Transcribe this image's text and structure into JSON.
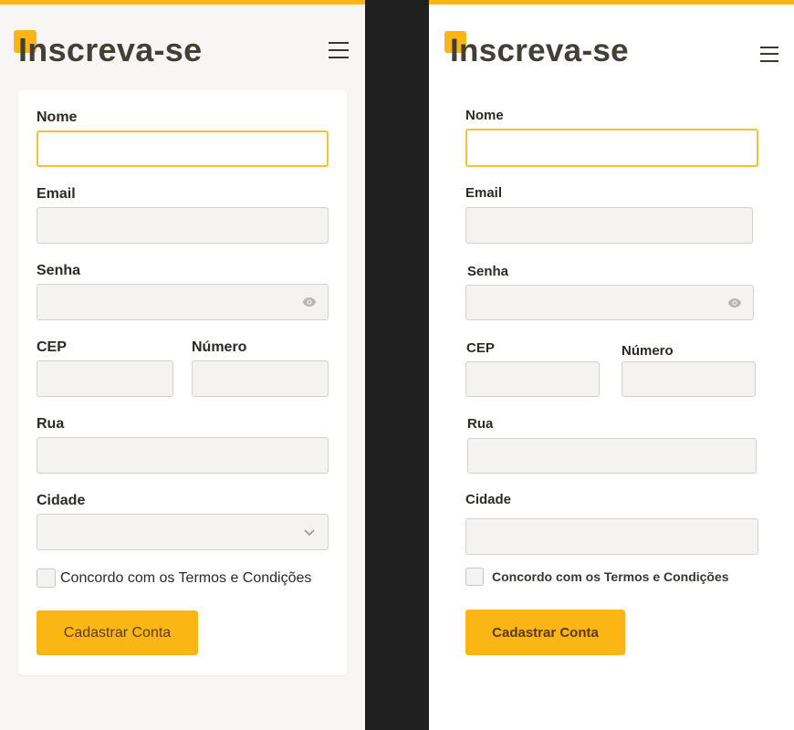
{
  "colors": {
    "accent": "#fbb615",
    "title_text": "#433f36",
    "focus_border": "#f7bf33",
    "divider_dark": "#202020"
  },
  "left": {
    "header": {
      "title": "Inscreva-se"
    },
    "form": {
      "nome": {
        "label": "Nome",
        "value": ""
      },
      "email": {
        "label": "Email",
        "value": ""
      },
      "senha": {
        "label": "Senha",
        "value": ""
      },
      "cep": {
        "label": "CEP",
        "value": ""
      },
      "numero": {
        "label": "Número",
        "value": ""
      },
      "rua": {
        "label": "Rua",
        "value": ""
      },
      "cidade": {
        "label": "Cidade",
        "selected": ""
      },
      "terms": {
        "label": "Concordo com os Termos e Condições",
        "checked": false
      },
      "submit": {
        "label": "Cadastrar Conta"
      }
    }
  },
  "right": {
    "header": {
      "title": "Inscreva-se"
    },
    "form": {
      "nome": {
        "label": "Nome",
        "value": ""
      },
      "email": {
        "label": "Email",
        "value": ""
      },
      "senha": {
        "label": "Senha",
        "value": ""
      },
      "cep": {
        "label": "CEP",
        "value": ""
      },
      "numero": {
        "label": "Número",
        "value": ""
      },
      "rua": {
        "label": "Rua",
        "value": ""
      },
      "cidade": {
        "label": "Cidade",
        "value": ""
      },
      "terms": {
        "label": "Concordo com os Termos e Condições",
        "checked": false
      },
      "submit": {
        "label": "Cadastrar Conta"
      }
    }
  }
}
